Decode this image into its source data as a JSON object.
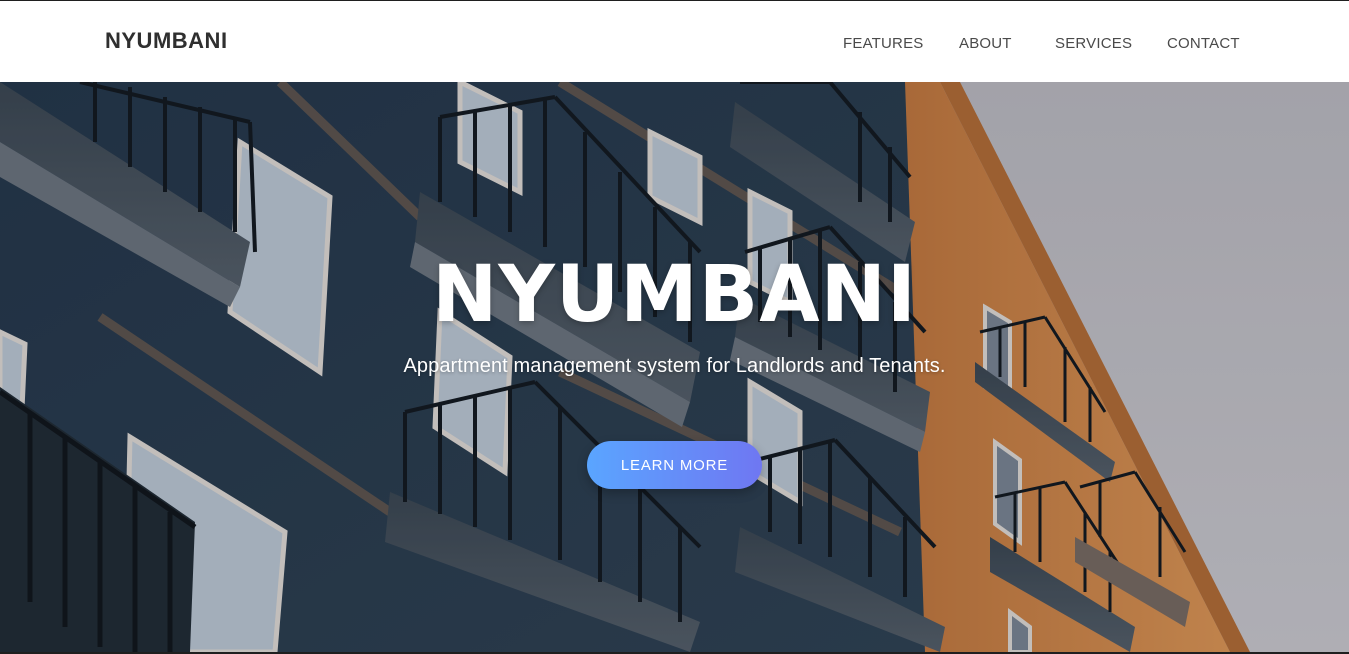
{
  "navbar": {
    "brand": "NYUMBANI",
    "links": [
      {
        "label": "FEATURES"
      },
      {
        "label": "ABOUT"
      },
      {
        "label": "SERVICES"
      },
      {
        "label": "CONTACT"
      }
    ]
  },
  "hero": {
    "title": "NYUMBANI",
    "subtitle": "Appartment management system for Landlords and Tenants.",
    "cta_label": "LEARN MORE",
    "background_image": "apartment-building-balconies"
  },
  "colors": {
    "nav_background": "#ffffff",
    "brand_text": "#2f2f2f",
    "nav_text": "#4a4a4a",
    "cta_gradient_start": "#5aa5ff",
    "cta_gradient_end": "#6f77f2",
    "building_blue": "#2c3e4c",
    "building_orange": "#d98a45",
    "sky": "#c9c9d0"
  }
}
